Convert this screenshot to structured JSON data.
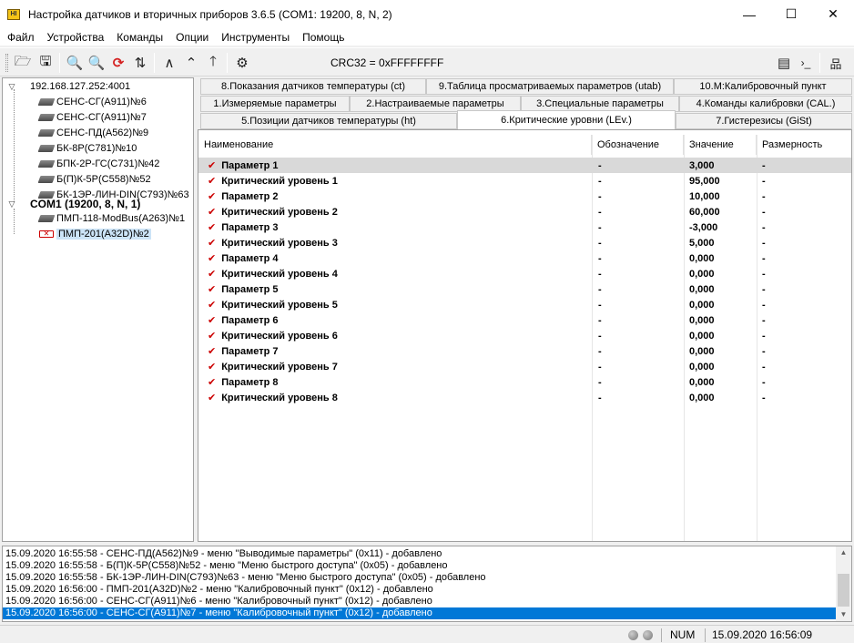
{
  "window": {
    "title": "Настройка датчиков и вторичных приборов 3.6.5 (COM1: 19200, 8, N, 2)",
    "icon_text": "HI",
    "minimize": "—",
    "maximize": "☐",
    "close": "✕"
  },
  "menu": [
    "Файл",
    "Устройства",
    "Команды",
    "Опции",
    "Инструменты",
    "Помощь"
  ],
  "toolbar": {
    "crc": "CRC32 = 0xFFFFFFFF",
    "icons": {
      "open": "🗁",
      "save": "🖫",
      "search": "🔍",
      "search_more": "🔍",
      "refresh": "⟳",
      "sort": "⇅",
      "up": "∧",
      "up_double": "⌃",
      "up_arrow": "🡑",
      "gears": "⚙",
      "window": "▤",
      "terminal": "›_",
      "network": "品"
    }
  },
  "tree": {
    "nodes": [
      {
        "label": "192.168.127.252:4001",
        "level": 0,
        "expanded": true
      },
      {
        "label": "СЕНС-СГ(А911)№6",
        "level": 1
      },
      {
        "label": "СЕНС-СГ(А911)№7",
        "level": 1
      },
      {
        "label": "СЕНС-ПД(А562)№9",
        "level": 1
      },
      {
        "label": "БК-8Р(С781)№10",
        "level": 1
      },
      {
        "label": "БПК-2Р-ГС(С731)№42",
        "level": 1
      },
      {
        "label": "Б(П)К-5Р(С558)№52",
        "level": 1
      },
      {
        "label": "БК-1ЭР-ЛИН-DIN(С793)№63",
        "level": 1
      },
      {
        "label": "COM1 (19200, 8, N, 1)",
        "level": 0,
        "expanded": true
      },
      {
        "label": "ПМП-118-ModBus(А263)№1",
        "level": 1
      },
      {
        "label": "ПМП-201(А32D)№2",
        "level": 1,
        "selected": true,
        "error": true
      }
    ]
  },
  "tabs": {
    "row1": [
      "8.Показания датчиков температуры (ct)",
      "9.Таблица просматриваемых параметров (utab)",
      "10.М:Калибровочный пункт"
    ],
    "row2": [
      "1.Измеряемые параметры",
      "2.Настраиваемые параметры",
      "3.Специальные параметры",
      "4.Команды калибровки (CAL.)"
    ],
    "row3": [
      "5.Позиции датчиков температуры (ht)",
      "6.Критические уровни (LEv.)",
      "7.Гистерезисы (GiSt)"
    ],
    "active": "6.Критические уровни (LEv.)"
  },
  "table": {
    "headers": [
      "Наименование",
      "Обозначение",
      "Значение",
      "Размерность"
    ],
    "rows": [
      {
        "name": "Параметр 1",
        "symbol": "-",
        "value": "3,000",
        "unit": "-"
      },
      {
        "name": "Критический уровень 1",
        "symbol": "-",
        "value": "95,000",
        "unit": "-"
      },
      {
        "name": "Параметр 2",
        "symbol": "-",
        "value": "10,000",
        "unit": "-"
      },
      {
        "name": "Критический уровень 2",
        "symbol": "-",
        "value": "60,000",
        "unit": "-"
      },
      {
        "name": "Параметр 3",
        "symbol": "-",
        "value": "-3,000",
        "unit": "-"
      },
      {
        "name": "Критический уровень 3",
        "symbol": "-",
        "value": "5,000",
        "unit": "-"
      },
      {
        "name": "Параметр 4",
        "symbol": "-",
        "value": "0,000",
        "unit": "-"
      },
      {
        "name": "Критический уровень 4",
        "symbol": "-",
        "value": "0,000",
        "unit": "-"
      },
      {
        "name": "Параметр 5",
        "symbol": "-",
        "value": "0,000",
        "unit": "-"
      },
      {
        "name": "Критический уровень 5",
        "symbol": "-",
        "value": "0,000",
        "unit": "-"
      },
      {
        "name": "Параметр 6",
        "symbol": "-",
        "value": "0,000",
        "unit": "-"
      },
      {
        "name": "Критический уровень 6",
        "symbol": "-",
        "value": "0,000",
        "unit": "-"
      },
      {
        "name": "Параметр 7",
        "symbol": "-",
        "value": "0,000",
        "unit": "-"
      },
      {
        "name": "Критический уровень 7",
        "symbol": "-",
        "value": "0,000",
        "unit": "-"
      },
      {
        "name": "Параметр 8",
        "symbol": "-",
        "value": "0,000",
        "unit": "-"
      },
      {
        "name": "Критический уровень 8",
        "symbol": "-",
        "value": "0,000",
        "unit": "-"
      }
    ],
    "selected_index": 0,
    "check_glyph": "✔"
  },
  "log": {
    "lines": [
      "15.09.2020 16:55:58 - СЕНС-ПД(А562)№9 - меню \"Выводимые параметры\" (0x11) - добавлено",
      "15.09.2020 16:55:58 - Б(П)К-5Р(С558)№52 - меню \"Меню быстрого доступа\" (0x05) - добавлено",
      "15.09.2020 16:55:58 - БК-1ЭР-ЛИН-DIN(С793)№63 - меню \"Меню быстрого доступа\" (0x05) - добавлено",
      "15.09.2020 16:56:00 - ПМП-201(А32D)№2 - меню \"Калибровочный пункт\" (0x12) - добавлено",
      "15.09.2020 16:56:00 - СЕНС-СГ(А911)№6 - меню \"Калибровочный пункт\" (0x12) - добавлено",
      "15.09.2020 16:56:00 - СЕНС-СГ(А911)№7 - меню \"Калибровочный пункт\" (0x12) - добавлено"
    ],
    "selected_index": 5
  },
  "status": {
    "num": "NUM",
    "datetime": "15.09.2020 16:56:09"
  }
}
